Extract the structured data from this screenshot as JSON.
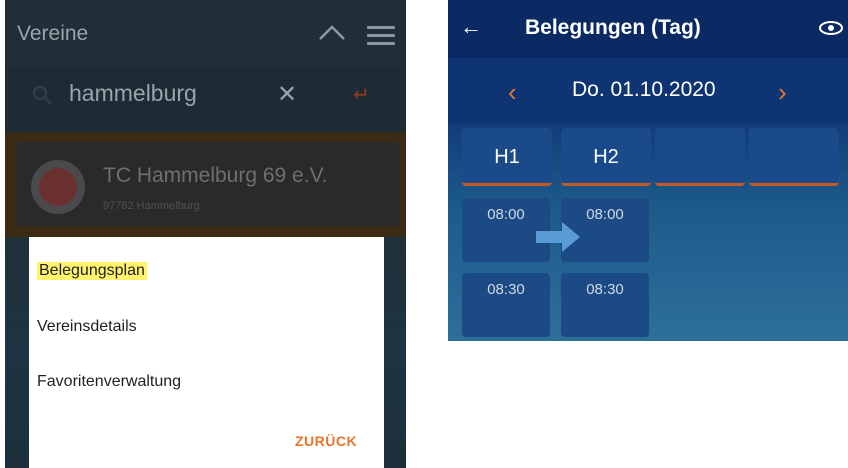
{
  "left_screen": {
    "header": {
      "title": "Vereine",
      "collapse_icon": "chevron-up-icon",
      "menu_icon": "hamburger-icon"
    },
    "search": {
      "query": "hammelburg",
      "clear_glyph": "✕",
      "submit_glyph": "↵"
    },
    "result": {
      "name": "TC Hammelburg 69 e.V.",
      "location": "97762 Hammelburg"
    },
    "dialog": {
      "items": [
        "Belegungsplan",
        "Vereinsdetails",
        "Favoritenverwaltung"
      ],
      "back_label": "ZURÜCK"
    }
  },
  "right_screen": {
    "header": {
      "back_glyph": "←",
      "title": "Belegungen (Tag)"
    },
    "date_nav": {
      "prev_glyph": "‹",
      "date": "Do. 01.10.2020",
      "next_glyph": "›"
    },
    "courts": [
      "H1",
      "H2",
      "",
      ""
    ],
    "time_slots": [
      {
        "row": [
          "08:00",
          "08:00"
        ]
      },
      {
        "row": [
          "08:30",
          "08:30"
        ]
      }
    ]
  },
  "colors": {
    "accent_orange": "#e8752a",
    "highlight_yellow": "#fff36b",
    "nav_blue": "#0b2a63"
  }
}
